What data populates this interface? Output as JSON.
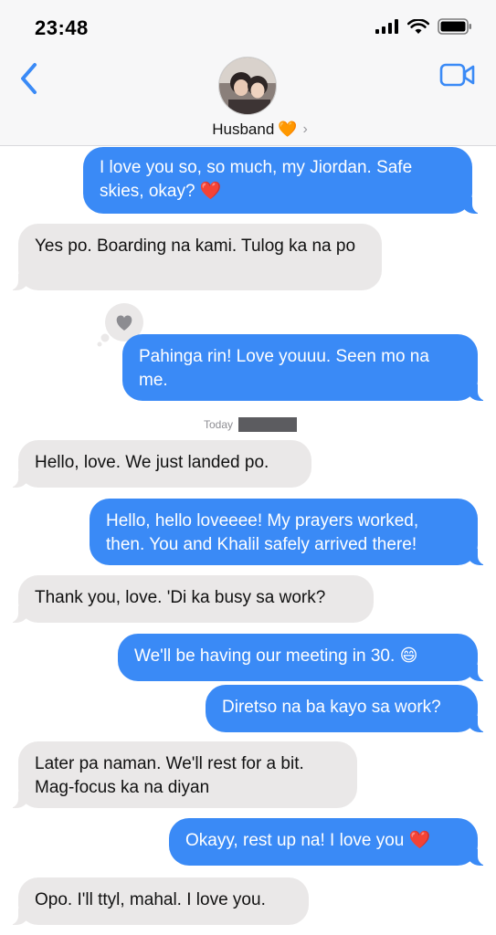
{
  "status": {
    "time": "23:48"
  },
  "header": {
    "contact_name": "Husband",
    "contact_emoji": "🧡",
    "chevron": "›"
  },
  "colors": {
    "accent": "#3a8af6",
    "incoming": "#eae8e8"
  },
  "today_label": "Today",
  "messages": [
    {
      "dir": "out",
      "text": "I love you so, so much, my Jiordan. Safe skies, okay?",
      "emoji": "❤️"
    },
    {
      "dir": "in",
      "text": "Yes po. Boarding na kami. Tulog ka na po"
    },
    {
      "dir": "out",
      "text": "Pahinga rin! Love youuu. Seen mo na me.",
      "tapback": "heart"
    },
    {
      "dir": "in",
      "text": "Hello, love. We just landed po."
    },
    {
      "dir": "out",
      "text": "Hello, hello loveeee! My prayers worked, then. You and Khalil safely arrived there!"
    },
    {
      "dir": "in",
      "text": "Thank you, love. 'Di ka busy sa work?"
    },
    {
      "dir": "out",
      "text": "We'll be having our meeting in 30.",
      "emoji": "😄"
    },
    {
      "dir": "out",
      "text": "Diretso na ba kayo sa work?"
    },
    {
      "dir": "in",
      "text": "Later pa naman. We'll rest for a bit. Mag-focus ka na diyan"
    },
    {
      "dir": "out",
      "text": "Okayy, rest up na! I love you",
      "emoji": "❤️"
    },
    {
      "dir": "in",
      "text": "Opo. I'll ttyl, mahal. I love you."
    }
  ]
}
